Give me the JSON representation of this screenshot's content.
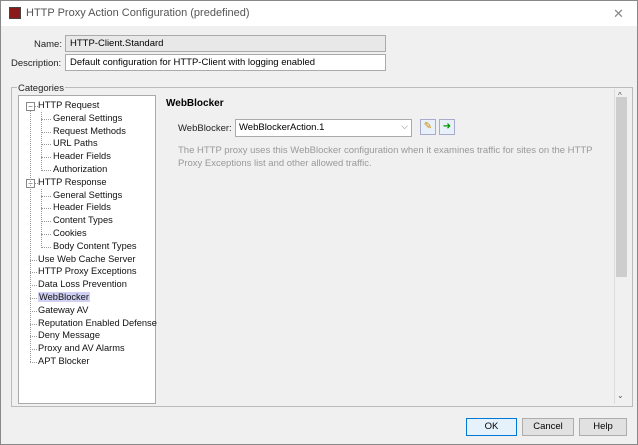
{
  "window": {
    "title": "HTTP Proxy Action Configuration (predefined)"
  },
  "form": {
    "name_label": "Name:",
    "name_value": "HTTP-Client.Standard",
    "description_label": "Description:",
    "description_value": "Default configuration for HTTP-Client with logging enabled"
  },
  "categories": {
    "label": "Categories",
    "items": [
      {
        "label": "HTTP Request",
        "level": 0,
        "expand": true
      },
      {
        "label": "General Settings",
        "level": 1
      },
      {
        "label": "Request Methods",
        "level": 1
      },
      {
        "label": "URL Paths",
        "level": 1
      },
      {
        "label": "Header Fields",
        "level": 1
      },
      {
        "label": "Authorization",
        "level": 1
      },
      {
        "label": "HTTP Response",
        "level": 0,
        "expand": true
      },
      {
        "label": "General Settings",
        "level": 1
      },
      {
        "label": "Header Fields",
        "level": 1
      },
      {
        "label": "Content Types",
        "level": 1
      },
      {
        "label": "Cookies",
        "level": 1
      },
      {
        "label": "Body Content Types",
        "level": 1
      },
      {
        "label": "Use Web Cache Server",
        "level": 0
      },
      {
        "label": "HTTP Proxy Exceptions",
        "level": 0
      },
      {
        "label": "Data Loss Prevention",
        "level": 0
      },
      {
        "label": "WebBlocker",
        "level": 0,
        "selected": true
      },
      {
        "label": "Gateway AV",
        "level": 0
      },
      {
        "label": "Reputation Enabled Defense",
        "level": 0
      },
      {
        "label": "Deny Message",
        "level": 0
      },
      {
        "label": "Proxy and AV Alarms",
        "level": 0
      },
      {
        "label": "APT Blocker",
        "level": 0
      }
    ]
  },
  "panel": {
    "title": "WebBlocker",
    "select_label": "WebBlocker:",
    "select_value": "WebBlockerAction.1",
    "help_text": "The HTTP proxy uses this WebBlocker configuration when it examines traffic for sites on the HTTP Proxy Exceptions list and other allowed traffic."
  },
  "buttons": {
    "ok": "OK",
    "cancel": "Cancel",
    "help": "Help"
  }
}
